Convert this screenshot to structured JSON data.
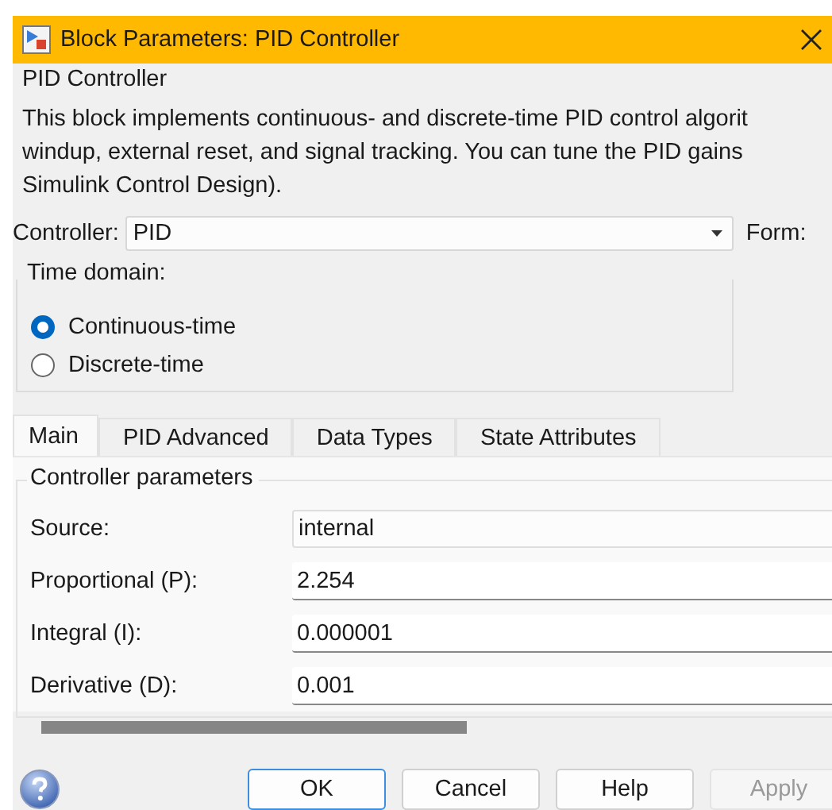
{
  "window": {
    "title": "Block Parameters: PID Controller"
  },
  "block": {
    "title": "PID Controller",
    "description": [
      "This block implements continuous- and discrete-time PID control algorit",
      "windup, external reset, and signal tracking. You can tune the PID gains",
      "Simulink Control Design)."
    ]
  },
  "controller": {
    "label": "Controller:",
    "value": "PID",
    "form_label": "Form:"
  },
  "time_domain": {
    "title": "Time domain:",
    "options": [
      {
        "label": "Continuous-time",
        "selected": true
      },
      {
        "label": "Discrete-time",
        "selected": false
      }
    ]
  },
  "tabs": [
    {
      "label": "Main",
      "selected": true
    },
    {
      "label": "PID Advanced",
      "selected": false
    },
    {
      "label": "Data Types",
      "selected": false
    },
    {
      "label": "State Attributes",
      "selected": false
    }
  ],
  "parameters": {
    "title": "Controller parameters",
    "rows": [
      {
        "label": "Source:",
        "value": "internal",
        "kind": "dropdown"
      },
      {
        "label": "Proportional (P):",
        "value": "2.254",
        "kind": "edit"
      },
      {
        "label": "Integral (I):",
        "value": "0.000001",
        "kind": "edit"
      },
      {
        "label": "Derivative (D):",
        "value": "0.001",
        "kind": "edit"
      }
    ]
  },
  "buttons": [
    {
      "label": "OK",
      "kind": "default",
      "disabled": false
    },
    {
      "label": "Cancel",
      "kind": "normal",
      "disabled": false
    },
    {
      "label": "Help",
      "kind": "normal",
      "disabled": false
    },
    {
      "label": "Apply",
      "kind": "normal",
      "disabled": true
    }
  ]
}
